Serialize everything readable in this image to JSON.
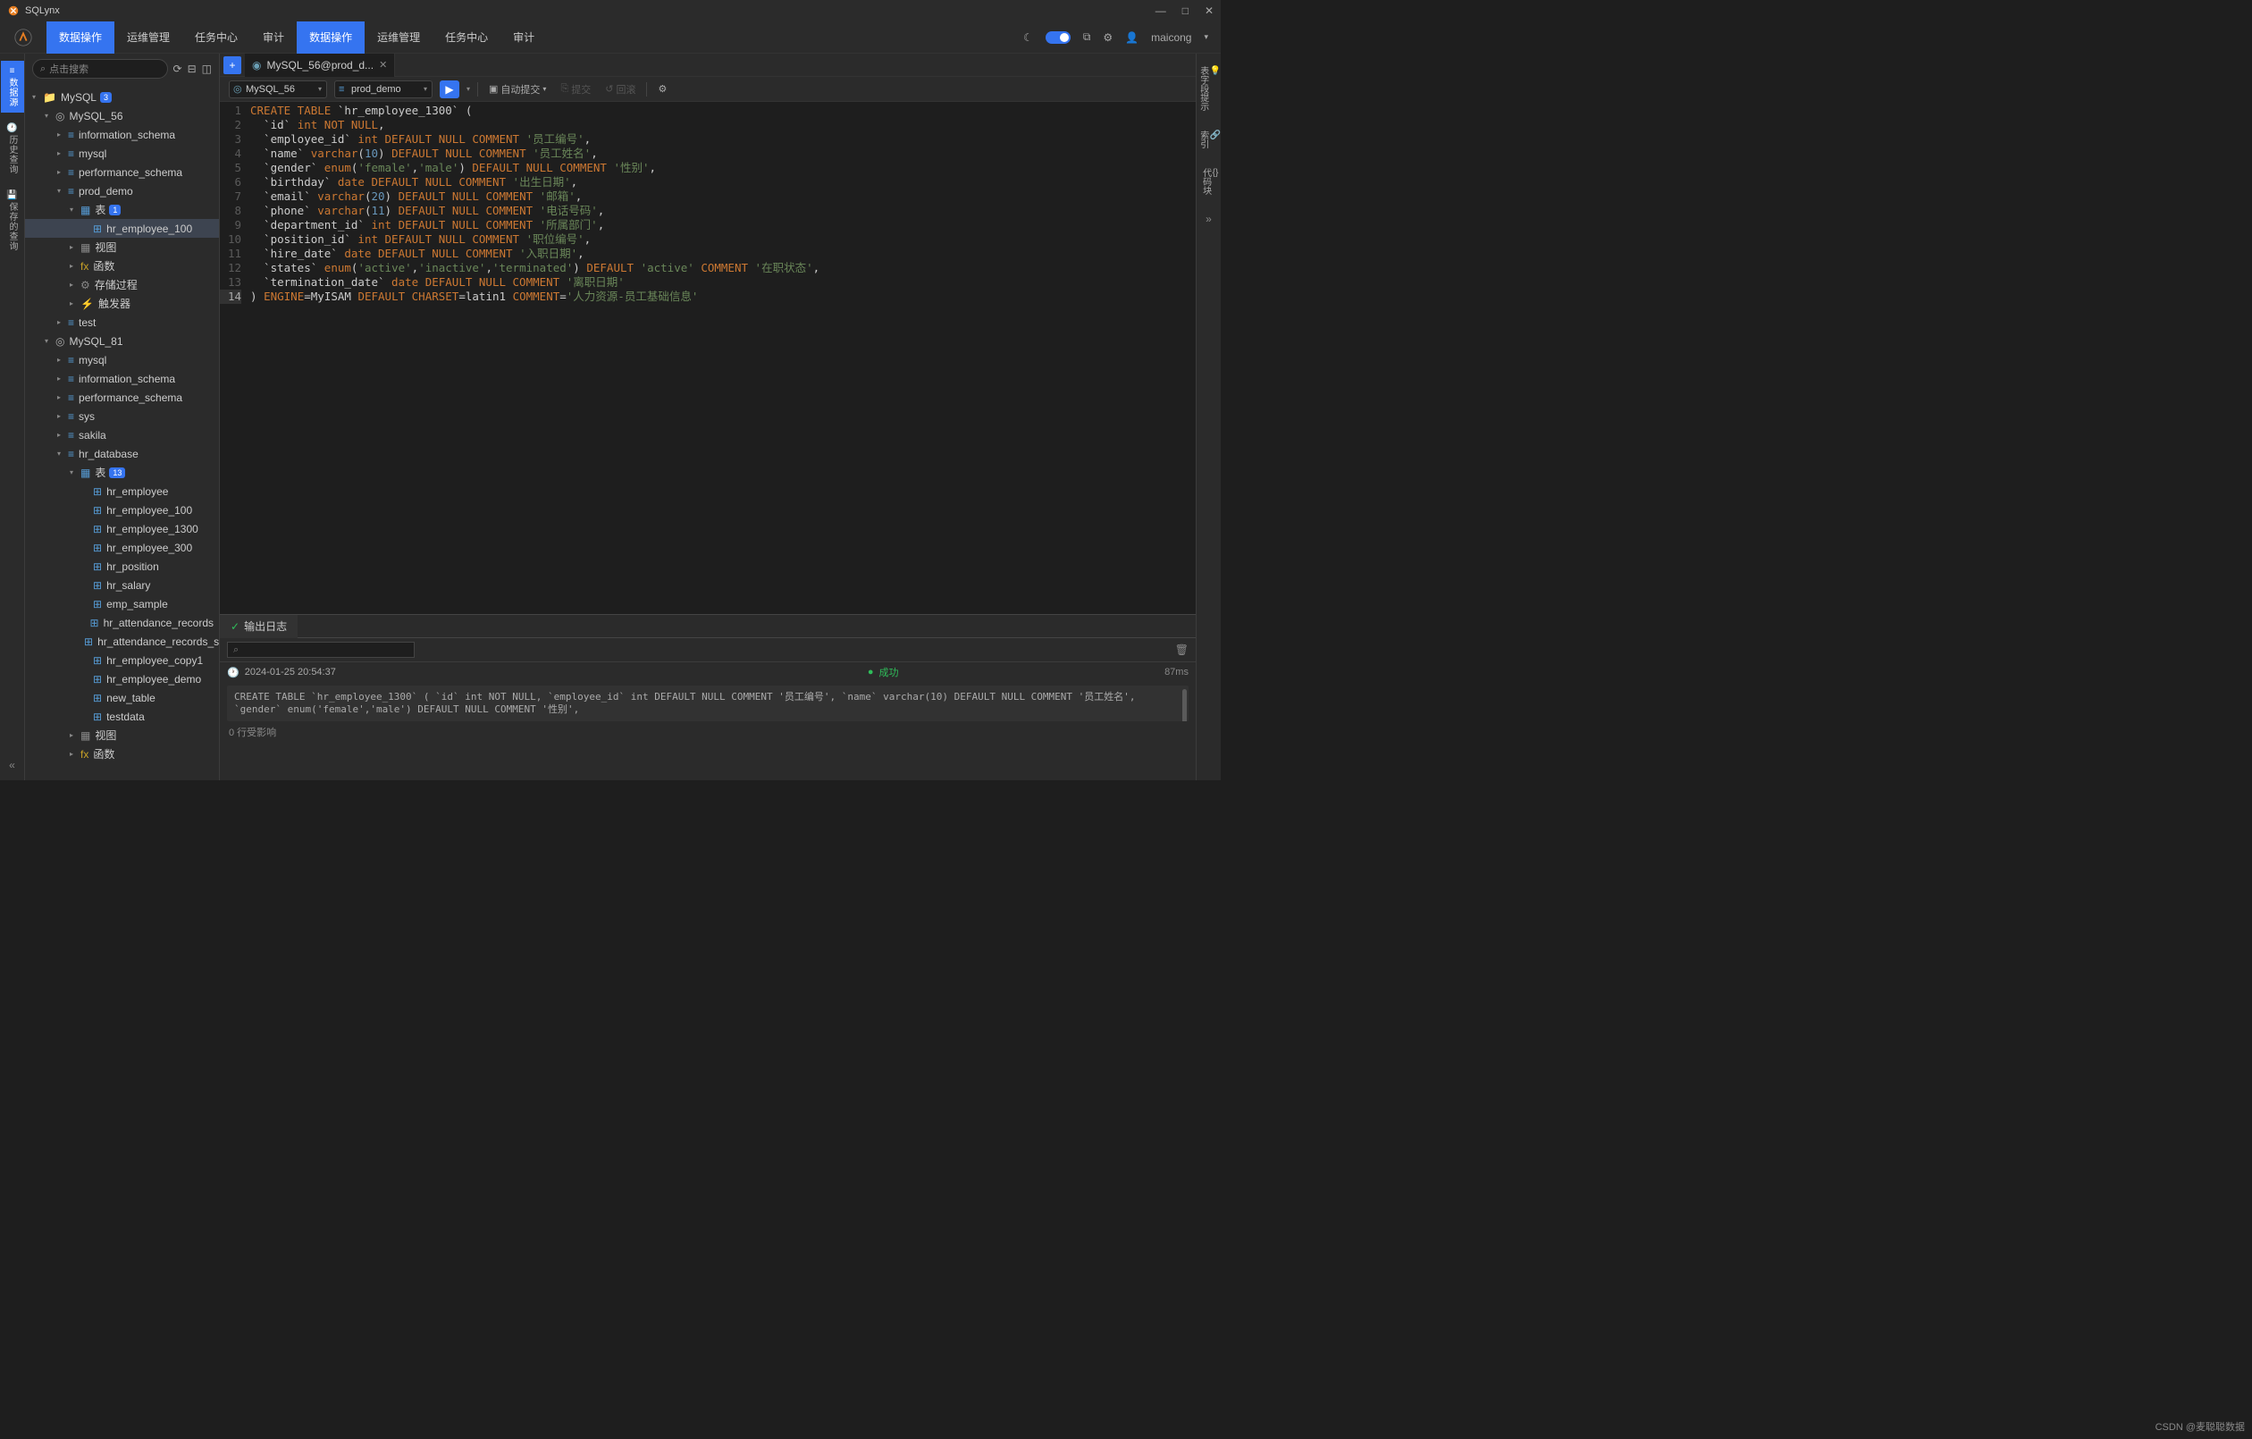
{
  "app": {
    "title": "SQLynx"
  },
  "menu": {
    "items": [
      "数据操作",
      "运维管理",
      "任务中心",
      "审计"
    ],
    "active_index": 0,
    "username": "maicong"
  },
  "left_rail": {
    "items": [
      {
        "label": "数据源",
        "active": true
      },
      {
        "label": "历史查询",
        "active": false
      },
      {
        "label": "保存的查询",
        "active": false
      }
    ]
  },
  "right_rail": {
    "items": [
      "表字段提示",
      "索引",
      "代码块"
    ]
  },
  "sidebar": {
    "search_placeholder": "点击搜索",
    "tree": [
      {
        "depth": 0,
        "arrow": "▾",
        "icon": "folder",
        "label": "MySQL",
        "badge": "3"
      },
      {
        "depth": 1,
        "arrow": "▾",
        "icon": "conn",
        "label": "MySQL_56"
      },
      {
        "depth": 2,
        "arrow": "▸",
        "icon": "db",
        "label": "information_schema"
      },
      {
        "depth": 2,
        "arrow": "▸",
        "icon": "db",
        "label": "mysql"
      },
      {
        "depth": 2,
        "arrow": "▸",
        "icon": "db",
        "label": "performance_schema"
      },
      {
        "depth": 2,
        "arrow": "▾",
        "icon": "db",
        "label": "prod_demo"
      },
      {
        "depth": 3,
        "arrow": "▾",
        "icon": "tbl-folder",
        "label": "表",
        "badge": "1"
      },
      {
        "depth": 4,
        "arrow": "",
        "icon": "table",
        "label": "hr_employee_100",
        "selected": true
      },
      {
        "depth": 3,
        "arrow": "▸",
        "icon": "view-folder",
        "label": "视图"
      },
      {
        "depth": 3,
        "arrow": "▸",
        "icon": "fn-folder",
        "label": "函数"
      },
      {
        "depth": 3,
        "arrow": "▸",
        "icon": "proc-folder",
        "label": "存储过程"
      },
      {
        "depth": 3,
        "arrow": "▸",
        "icon": "trig-folder",
        "label": "触发器"
      },
      {
        "depth": 2,
        "arrow": "▸",
        "icon": "db",
        "label": "test"
      },
      {
        "depth": 1,
        "arrow": "▾",
        "icon": "conn",
        "label": "MySQL_81"
      },
      {
        "depth": 2,
        "arrow": "▸",
        "icon": "db",
        "label": "mysql"
      },
      {
        "depth": 2,
        "arrow": "▸",
        "icon": "db",
        "label": "information_schema"
      },
      {
        "depth": 2,
        "arrow": "▸",
        "icon": "db",
        "label": "performance_schema"
      },
      {
        "depth": 2,
        "arrow": "▸",
        "icon": "db",
        "label": "sys"
      },
      {
        "depth": 2,
        "arrow": "▸",
        "icon": "db",
        "label": "sakila"
      },
      {
        "depth": 2,
        "arrow": "▾",
        "icon": "db",
        "label": "hr_database"
      },
      {
        "depth": 3,
        "arrow": "▾",
        "icon": "tbl-folder",
        "label": "表",
        "badge": "13"
      },
      {
        "depth": 4,
        "arrow": "",
        "icon": "table",
        "label": "hr_employee"
      },
      {
        "depth": 4,
        "arrow": "",
        "icon": "table",
        "label": "hr_employee_100"
      },
      {
        "depth": 4,
        "arrow": "",
        "icon": "table",
        "label": "hr_employee_1300"
      },
      {
        "depth": 4,
        "arrow": "",
        "icon": "table",
        "label": "hr_employee_300"
      },
      {
        "depth": 4,
        "arrow": "",
        "icon": "table",
        "label": "hr_position"
      },
      {
        "depth": 4,
        "arrow": "",
        "icon": "table",
        "label": "hr_salary"
      },
      {
        "depth": 4,
        "arrow": "",
        "icon": "table",
        "label": "emp_sample"
      },
      {
        "depth": 4,
        "arrow": "",
        "icon": "table",
        "label": "hr_attendance_records"
      },
      {
        "depth": 4,
        "arrow": "",
        "icon": "table",
        "label": "hr_attendance_records_s"
      },
      {
        "depth": 4,
        "arrow": "",
        "icon": "table",
        "label": "hr_employee_copy1"
      },
      {
        "depth": 4,
        "arrow": "",
        "icon": "table",
        "label": "hr_employee_demo"
      },
      {
        "depth": 4,
        "arrow": "",
        "icon": "table",
        "label": "new_table"
      },
      {
        "depth": 4,
        "arrow": "",
        "icon": "table",
        "label": "testdata"
      },
      {
        "depth": 3,
        "arrow": "▸",
        "icon": "view-folder",
        "label": "视图"
      },
      {
        "depth": 3,
        "arrow": "▸",
        "icon": "fn-folder",
        "label": "函数"
      }
    ]
  },
  "tabs": {
    "items": [
      {
        "label": "MySQL_56@prod_d..."
      }
    ]
  },
  "toolbar": {
    "conn": "MySQL_56",
    "db": "prod_demo",
    "autocommit": "自动提交",
    "commit": "提交",
    "rollback": "回滚"
  },
  "code": {
    "lines": [
      [
        [
          "kw",
          "CREATE TABLE"
        ],
        [
          "",
          " `hr_employee_1300` ("
        ]
      ],
      [
        [
          "",
          "  `id` "
        ],
        [
          "typ",
          "int"
        ],
        [
          "",
          " "
        ],
        [
          "kw",
          "NOT NULL"
        ],
        [
          "",
          ","
        ]
      ],
      [
        [
          "",
          "  `employee_id` "
        ],
        [
          "typ",
          "int"
        ],
        [
          "",
          " "
        ],
        [
          "kw",
          "DEFAULT NULL"
        ],
        [
          "",
          " "
        ],
        [
          "kw",
          "COMMENT"
        ],
        [
          "",
          " "
        ],
        [
          "str",
          "'员工编号'"
        ],
        [
          "",
          ","
        ]
      ],
      [
        [
          "",
          "  `name` "
        ],
        [
          "typ",
          "varchar"
        ],
        [
          "",
          "("
        ],
        [
          "num",
          "10"
        ],
        [
          "",
          ") "
        ],
        [
          "kw",
          "DEFAULT NULL"
        ],
        [
          "",
          " "
        ],
        [
          "kw",
          "COMMENT"
        ],
        [
          "",
          " "
        ],
        [
          "str",
          "'员工姓名'"
        ],
        [
          "",
          ","
        ]
      ],
      [
        [
          "",
          "  `gender` "
        ],
        [
          "typ",
          "enum"
        ],
        [
          "",
          "("
        ],
        [
          "str",
          "'female'"
        ],
        [
          "",
          ","
        ],
        [
          "str",
          "'male'"
        ],
        [
          "",
          ") "
        ],
        [
          "kw",
          "DEFAULT NULL"
        ],
        [
          "",
          " "
        ],
        [
          "kw",
          "COMMENT"
        ],
        [
          "",
          " "
        ],
        [
          "str",
          "'性别'"
        ],
        [
          "",
          ","
        ]
      ],
      [
        [
          "",
          "  `birthday` "
        ],
        [
          "typ",
          "date"
        ],
        [
          "",
          " "
        ],
        [
          "kw",
          "DEFAULT NULL"
        ],
        [
          "",
          " "
        ],
        [
          "kw",
          "COMMENT"
        ],
        [
          "",
          " "
        ],
        [
          "str",
          "'出生日期'"
        ],
        [
          "",
          ","
        ]
      ],
      [
        [
          "",
          "  `email` "
        ],
        [
          "typ",
          "varchar"
        ],
        [
          "",
          "("
        ],
        [
          "num",
          "20"
        ],
        [
          "",
          ") "
        ],
        [
          "kw",
          "DEFAULT NULL"
        ],
        [
          "",
          " "
        ],
        [
          "kw",
          "COMMENT"
        ],
        [
          "",
          " "
        ],
        [
          "str",
          "'邮箱'"
        ],
        [
          "",
          ","
        ]
      ],
      [
        [
          "",
          "  `phone` "
        ],
        [
          "typ",
          "varchar"
        ],
        [
          "",
          "("
        ],
        [
          "num",
          "11"
        ],
        [
          "",
          ") "
        ],
        [
          "kw",
          "DEFAULT NULL"
        ],
        [
          "",
          " "
        ],
        [
          "kw",
          "COMMENT"
        ],
        [
          "",
          " "
        ],
        [
          "str",
          "'电话号码'"
        ],
        [
          "",
          ","
        ]
      ],
      [
        [
          "",
          "  `department_id` "
        ],
        [
          "typ",
          "int"
        ],
        [
          "",
          " "
        ],
        [
          "kw",
          "DEFAULT NULL"
        ],
        [
          "",
          " "
        ],
        [
          "kw",
          "COMMENT"
        ],
        [
          "",
          " "
        ],
        [
          "str",
          "'所属部门'"
        ],
        [
          "",
          ","
        ]
      ],
      [
        [
          "",
          "  `position_id` "
        ],
        [
          "typ",
          "int"
        ],
        [
          "",
          " "
        ],
        [
          "kw",
          "DEFAULT NULL"
        ],
        [
          "",
          " "
        ],
        [
          "kw",
          "COMMENT"
        ],
        [
          "",
          " "
        ],
        [
          "str",
          "'职位编号'"
        ],
        [
          "",
          ","
        ]
      ],
      [
        [
          "",
          "  `hire_date` "
        ],
        [
          "typ",
          "date"
        ],
        [
          "",
          " "
        ],
        [
          "kw",
          "DEFAULT NULL"
        ],
        [
          "",
          " "
        ],
        [
          "kw",
          "COMMENT"
        ],
        [
          "",
          " "
        ],
        [
          "str",
          "'入职日期'"
        ],
        [
          "",
          ","
        ]
      ],
      [
        [
          "",
          "  `states` "
        ],
        [
          "typ",
          "enum"
        ],
        [
          "",
          "("
        ],
        [
          "str",
          "'active'"
        ],
        [
          "",
          ","
        ],
        [
          "str",
          "'inactive'"
        ],
        [
          "",
          ","
        ],
        [
          "str",
          "'terminated'"
        ],
        [
          "",
          ") "
        ],
        [
          "kw",
          "DEFAULT"
        ],
        [
          "",
          " "
        ],
        [
          "str",
          "'active'"
        ],
        [
          "",
          " "
        ],
        [
          "kw",
          "COMMENT"
        ],
        [
          "",
          " "
        ],
        [
          "str",
          "'在职状态'"
        ],
        [
          "",
          ","
        ]
      ],
      [
        [
          "",
          "  `termination_date` "
        ],
        [
          "typ",
          "date"
        ],
        [
          "",
          " "
        ],
        [
          "kw",
          "DEFAULT NULL"
        ],
        [
          "",
          " "
        ],
        [
          "kw",
          "COMMENT"
        ],
        [
          "",
          " "
        ],
        [
          "str",
          "'离职日期'"
        ]
      ],
      [
        [
          "",
          ") "
        ],
        [
          "kw",
          "ENGINE"
        ],
        [
          "",
          "=MyISAM "
        ],
        [
          "kw",
          "DEFAULT"
        ],
        [
          "",
          " "
        ],
        [
          "kw",
          "CHARSET"
        ],
        [
          "",
          "=latin1 "
        ],
        [
          "kw",
          "COMMENT"
        ],
        [
          "",
          "="
        ],
        [
          "str",
          "'人力资源-员工基础信息'"
        ]
      ]
    ],
    "active_line": 14
  },
  "output": {
    "tab": "输出日志",
    "timestamp": "2024-01-25 20:54:37",
    "status": "成功",
    "duration": "87ms",
    "sql_preview": "CREATE TABLE `hr_employee_1300` (\n  `id` int NOT NULL,\n  `employee_id` int DEFAULT NULL COMMENT '员工编号',\n  `name` varchar(10) DEFAULT NULL COMMENT '员工姓名',\n  `gender` enum('female','male') DEFAULT NULL COMMENT '性别',",
    "affected": "0 行受影响"
  },
  "watermark": "CSDN @麦聪聪数据"
}
